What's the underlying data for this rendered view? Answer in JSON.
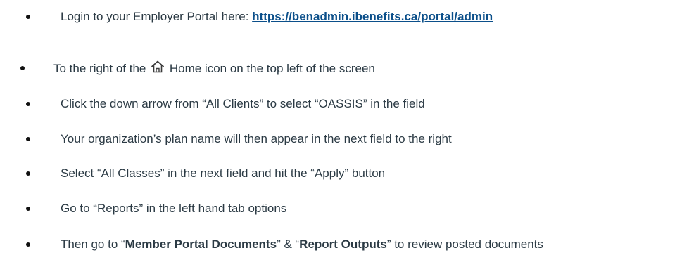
{
  "instructions": {
    "item1": {
      "prefix": "Login to your Employer Portal here: ",
      "link_text": "https://benadmin.ibenefits.ca/portal/admin"
    },
    "item2": {
      "before_icon": "To the right of the",
      "icon": "home-icon",
      "after_icon": "Home icon on the top left of the screen"
    },
    "item3": "Click the down arrow from “All Clients” to select “OASSIS” in the field",
    "item4": "Your organization’s plan name will then appear in the next field to the right",
    "item5": "Select “All Classes” in the next field and hit the “Apply” button",
    "item6": "Go to “Reports” in the left hand tab options",
    "item7": {
      "p1": "Then go to “",
      "b1": "Member Portal Documents",
      "p2": "” & “",
      "b2": "Report Outputs",
      "p3": "” to review posted documents"
    }
  },
  "colors": {
    "text": "#2b3a44",
    "link": "#0b4f8a"
  }
}
